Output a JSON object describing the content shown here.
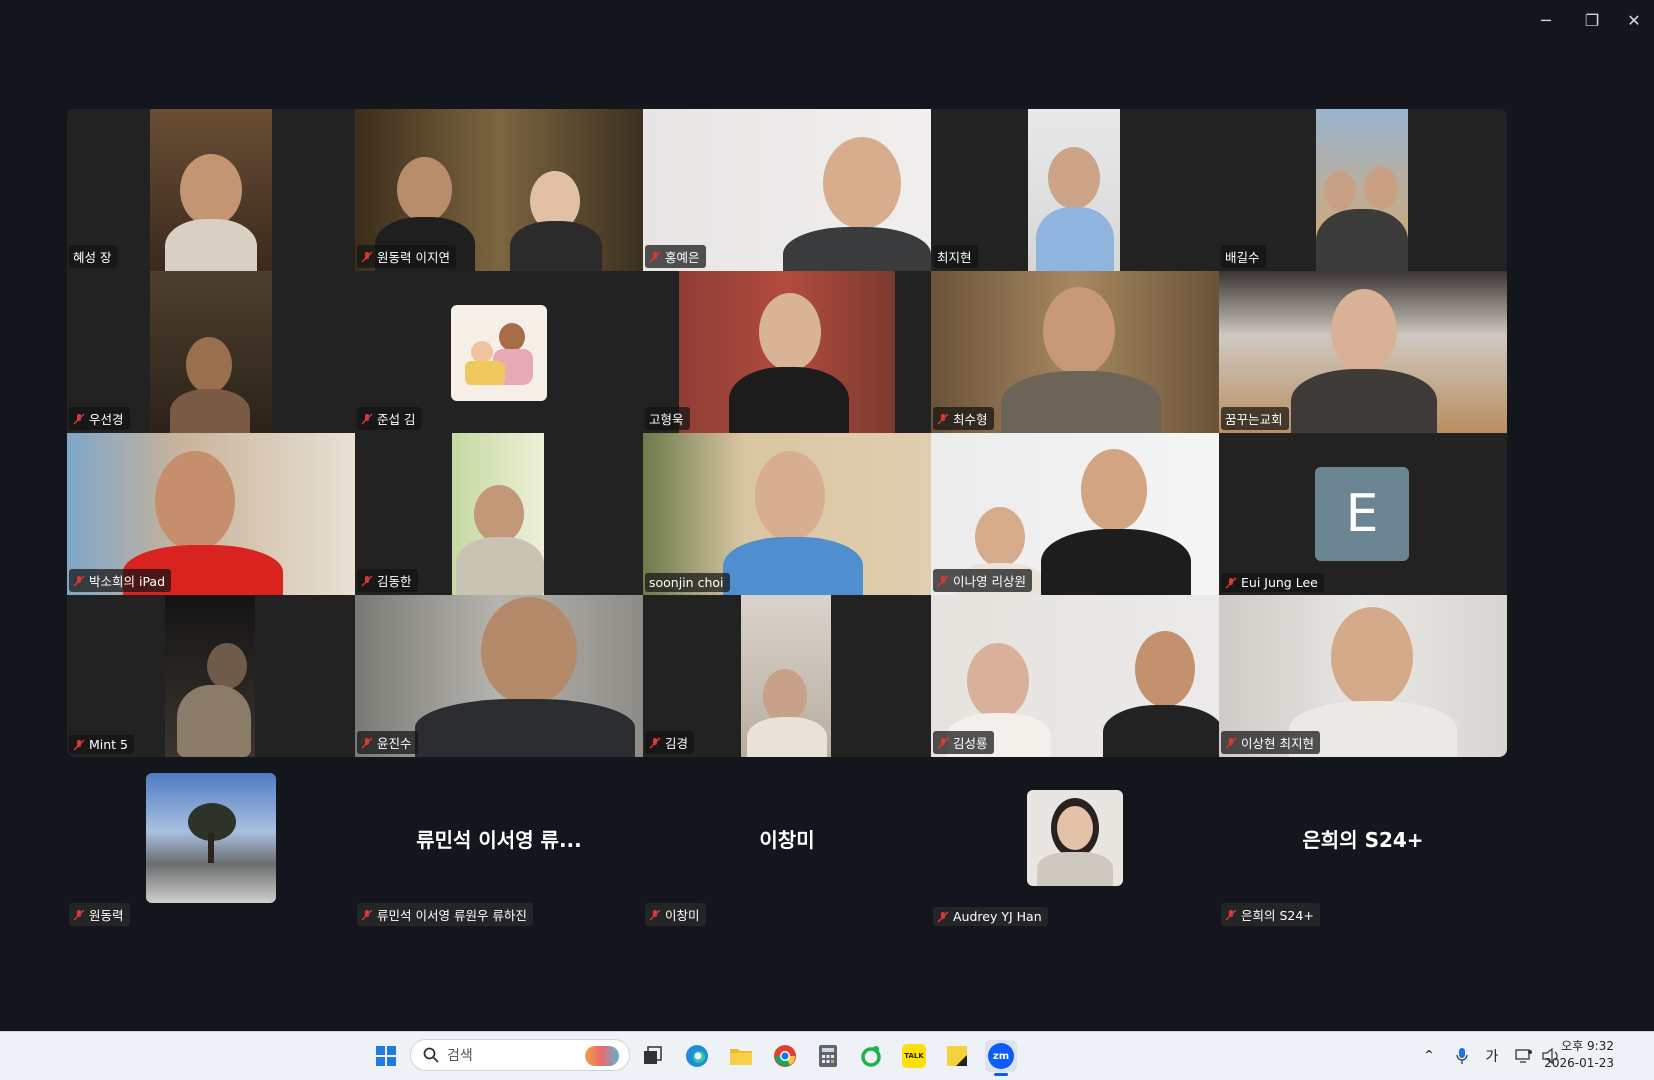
{
  "window_controls": {
    "minimize": "─",
    "restore": "❐",
    "close": "✕"
  },
  "participants": [
    {
      "name": "혜성 장",
      "muted": false
    },
    {
      "name": "원동력 이지연",
      "muted": true
    },
    {
      "name": "홍예은",
      "muted": true
    },
    {
      "name": "최지현",
      "muted": false
    },
    {
      "name": "배길수",
      "muted": false
    },
    {
      "name": "우선경",
      "muted": true
    },
    {
      "name": "준섭 김",
      "muted": true
    },
    {
      "name": "고형욱",
      "muted": false
    },
    {
      "name": "최수형",
      "muted": true
    },
    {
      "name": "꿈꾸는교회",
      "muted": false,
      "active": true
    },
    {
      "name": "박소희의 iPad",
      "muted": true
    },
    {
      "name": "김동한",
      "muted": true
    },
    {
      "name": "soonjin choi",
      "muted": false
    },
    {
      "name": "이나영 리상원",
      "muted": true
    },
    {
      "name": "Eui Jung Lee",
      "muted": true,
      "avatar_letter": "E"
    },
    {
      "name": "Mint 5",
      "muted": true
    },
    {
      "name": "윤진수",
      "muted": true
    },
    {
      "name": "김경",
      "muted": true
    },
    {
      "name": "김성룡",
      "muted": true
    },
    {
      "name": "이상현 최지현",
      "muted": true
    }
  ],
  "bottom_participants": [
    {
      "name": "원동력",
      "display": "",
      "muted": true
    },
    {
      "name": "류민석 이서영 류원우 류하진",
      "display": "류민석 이서영 류...",
      "muted": true
    },
    {
      "name": "이창미",
      "display": "이창미",
      "muted": true
    },
    {
      "name": "Audrey YJ Han",
      "display": "",
      "muted": true
    },
    {
      "name": "은희의 S24+",
      "display": "은희의 S24+",
      "muted": true
    }
  ],
  "taskbar": {
    "search_placeholder": "검색",
    "ime": "가",
    "time": "오후 9:32",
    "date": "2026-01-23",
    "apps": [
      "start-icon",
      "search-icon",
      "task-view-icon",
      "edge-icon",
      "file-explorer-icon",
      "chrome-icon",
      "calculator-icon",
      "naver-whale-icon",
      "kakaotalk-icon",
      "sticky-notes-icon",
      "zoom-icon"
    ],
    "kakao_label": "TALK",
    "zoom_label": "zm"
  },
  "colors": {
    "background": "#13171d",
    "tile": "#222222",
    "active_border": "#23d160",
    "avatar": "#6c8593",
    "mute": "#e03535",
    "taskbar": "#eef1f6"
  }
}
